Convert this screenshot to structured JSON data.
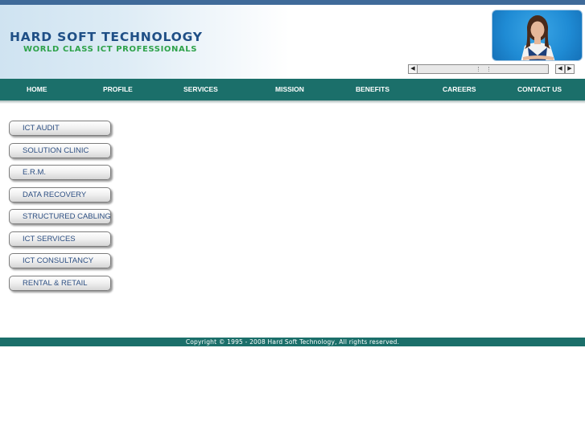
{
  "brand": {
    "title": "HARD SOFT TECHNOLOGY",
    "tagline": "WORLD CLASS ICT PROFESSIONALS"
  },
  "nav": {
    "items": [
      {
        "label": "HOME"
      },
      {
        "label": "PROFILE"
      },
      {
        "label": "SERVICES"
      },
      {
        "label": "MISSION"
      },
      {
        "label": "BENEFITS"
      },
      {
        "label": "CAREERS"
      },
      {
        "label": "CONTACT US"
      }
    ]
  },
  "sidebar": {
    "items": [
      {
        "label": "ICT AUDIT"
      },
      {
        "label": "SOLUTION CLINIC"
      },
      {
        "label": "E.R.M."
      },
      {
        "label": "DATA RECOVERY"
      },
      {
        "label": "STRUCTURED CABLING"
      },
      {
        "label": "ICT SERVICES"
      },
      {
        "label": "ICT CONSULTANCY"
      },
      {
        "label": "RENTAL & RETAIL"
      }
    ]
  },
  "footer": {
    "copyright": "Copyright © 1995 - 2008 Hard Soft Technology, All rights reserved."
  },
  "colors": {
    "topbar": "#3f6a99",
    "nav_background": "#1b6f6a",
    "brand_title": "#1f4f86",
    "brand_tagline": "#2ea24a",
    "sidebar_text": "#2d4f82"
  },
  "icons": {
    "slider_left": "triangle-left-icon",
    "prev": "triangle-left-icon",
    "next": "triangle-right-icon"
  }
}
